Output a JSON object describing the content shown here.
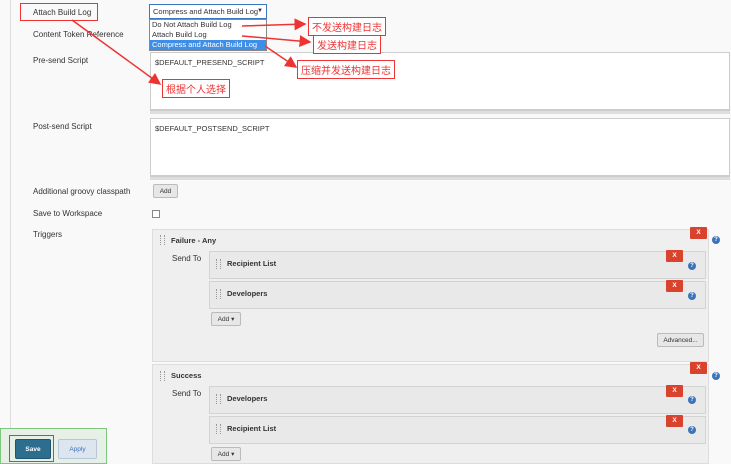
{
  "form": {
    "attach_build_log_label": "Attach Build Log",
    "content_token_label": "Content Token Reference",
    "presend_label": "Pre-send Script",
    "postsend_label": "Post-send Script",
    "groovy_label": "Additional groovy classpath",
    "save_workspace_label": "Save to Workspace",
    "triggers_label": "Triggers",
    "select_value": "Compress and Attach Build Log",
    "dropdown_options": [
      "Do Not Attach Build Log",
      "Attach Build Log",
      "Compress and Attach Build Log"
    ],
    "presend_value": "$DEFAULT_PRESEND_SCRIPT",
    "postsend_value": "$DEFAULT_POSTSEND_SCRIPT",
    "add_label": "Add"
  },
  "triggers": [
    {
      "name": "Failure - Any",
      "send_to_label": "Send To",
      "recipients": [
        "Recipient List",
        "Developers"
      ],
      "add_label": "Add",
      "advanced_label": "Advanced..."
    },
    {
      "name": "Success",
      "send_to_label": "Send To",
      "recipients": [
        "Developers",
        "Recipient List"
      ],
      "add_label": "Add"
    }
  ],
  "x_label": "X",
  "help_label": "?",
  "buttons": {
    "save": "Save",
    "apply": "Apply"
  },
  "annotations": {
    "a1": "不发送构建日志",
    "a2": "发送构建日志",
    "a3": "压缩并发送构建日志",
    "a4": "根据个人选择"
  },
  "colors": {
    "accent_blue": "#3d8ee8",
    "delete_red": "#d9432e",
    "annotation_red": "#e33",
    "save_teal": "#2d6e8e"
  }
}
